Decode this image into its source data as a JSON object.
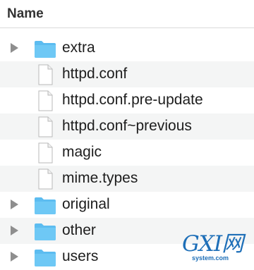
{
  "header": {
    "title": "Name"
  },
  "rows": [
    {
      "label": "extra",
      "kind": "folder",
      "expandable": true,
      "icon": "folder-icon"
    },
    {
      "label": "httpd.conf",
      "kind": "file",
      "expandable": false,
      "icon": "file-icon"
    },
    {
      "label": "httpd.conf.pre-update",
      "kind": "file",
      "expandable": false,
      "icon": "file-icon"
    },
    {
      "label": "httpd.conf~previous",
      "kind": "file",
      "expandable": false,
      "icon": "file-icon"
    },
    {
      "label": "magic",
      "kind": "file",
      "expandable": false,
      "icon": "file-icon"
    },
    {
      "label": "mime.types",
      "kind": "file",
      "expandable": false,
      "icon": "file-icon"
    },
    {
      "label": "original",
      "kind": "folder",
      "expandable": true,
      "icon": "folder-icon"
    },
    {
      "label": "other",
      "kind": "folder",
      "expandable": true,
      "icon": "folder-icon"
    },
    {
      "label": "users",
      "kind": "folder",
      "expandable": true,
      "icon": "folder-icon"
    }
  ],
  "watermark": {
    "logo": "GXI网",
    "subtitle": "system.com"
  },
  "colors": {
    "folder": "#5cbcf0",
    "disclosure": "#8e8e8e",
    "stripe": "#f4f5f5"
  }
}
